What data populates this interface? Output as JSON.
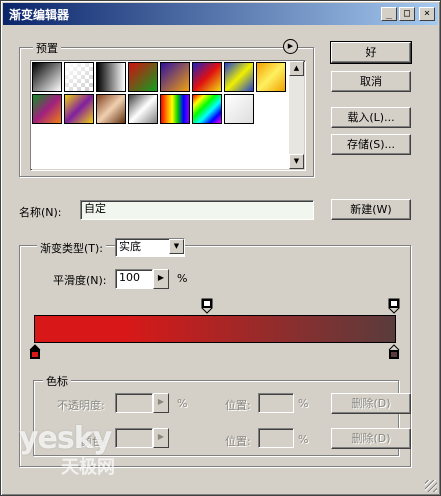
{
  "window": {
    "title": "渐变编辑器",
    "controls": [
      "_",
      "□",
      "×"
    ]
  },
  "presets": {
    "label": "预置",
    "menu_icon": "circle-arrow-right-icon",
    "swatches": [
      "linear-gradient(135deg,#000,#fff)",
      "linear-gradient(135deg,#fff,rgba(255,255,255,0))",
      "linear-gradient(90deg,#000,#fff)",
      "linear-gradient(135deg,#d01010,#10a020)",
      "linear-gradient(135deg,#3010a0,#f0a010)",
      "linear-gradient(135deg,#2020c0,#e01010,#f0e010)",
      "linear-gradient(135deg,#2040d0,#f0f000,#2040d0)",
      "linear-gradient(135deg,#f0a000,#fff060,#f0a000)",
      "linear-gradient(135deg,#109020,#a02080,#f08010)",
      "linear-gradient(135deg,#f0d010,#8020a0,#f0d010)",
      "linear-gradient(135deg,#804020,#f0d0b0,#603010)",
      "linear-gradient(135deg,#404040,#fff,#808080)",
      "linear-gradient(90deg,#f00,#f80,#ff0,#0c0,#00f,#80f)",
      "linear-gradient(135deg,#f00,#ff0,#0f0,#0ff,#00f,#f0f)",
      "linear-gradient(135deg,#fff,#ddd)"
    ]
  },
  "buttons": {
    "ok": "好",
    "cancel": "取消",
    "load": "载入(L)...",
    "save": "存储(S)...",
    "new": "新建(W)"
  },
  "name_field": {
    "label": "名称(N):",
    "value": "自定"
  },
  "gradient_type": {
    "label": "渐变类型(T):",
    "value": "实底"
  },
  "smoothness": {
    "label": "平滑度(N):",
    "value": "100",
    "unit": "%"
  },
  "colors": {
    "bar_colors": [
      "#d81818",
      "#5a3c3c"
    ]
  },
  "stops": {
    "label": "色标",
    "opacity_label": "不透明度:",
    "opacity_unit": "%",
    "location_label": "位置:",
    "location_unit": "%",
    "delete_label": "删除(D)",
    "color_label": "颜色:",
    "location2_label": "位置:",
    "location2_unit": "%",
    "delete2_label": "删除(D)"
  },
  "watermark": {
    "main": "yesky",
    "sub": "天极网"
  }
}
